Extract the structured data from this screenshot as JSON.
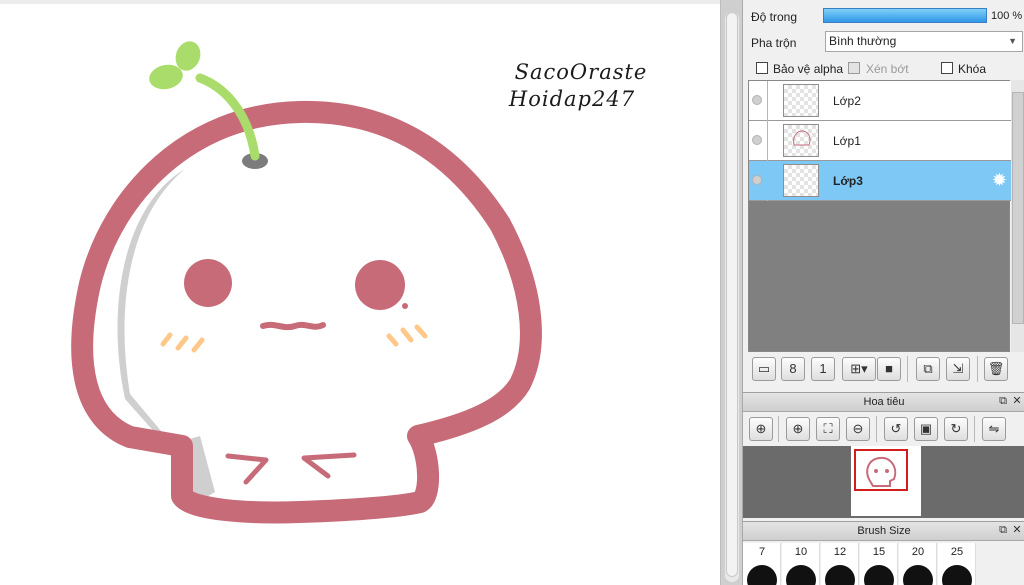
{
  "canvas": {
    "signature_line1": "SacoOraste",
    "signature_line2": "Hoidap247",
    "colors": {
      "outline": "#c76b79",
      "sprout": "#a9dc6a",
      "shade": "#cfcfcf",
      "blush": "#ffc78a"
    }
  },
  "layer_panel": {
    "opacity_label": "Độ trong",
    "opacity_value": "100 %",
    "opacity_fraction": 1.0,
    "blend_label": "Pha trộn",
    "blend_value": "Bình thường",
    "protect_alpha_label": "Bảo vệ alpha",
    "clipping_label": "Xén bớt",
    "lock_label": "Khóa",
    "layers": [
      {
        "name": "Lớp2",
        "selected": false
      },
      {
        "name": "Lớp1",
        "selected": false
      },
      {
        "name": "Lớp3",
        "selected": true
      }
    ],
    "accent_color": "#7ec8f6"
  },
  "layer_toolbar": {
    "icons": [
      "new-layer-icon",
      "new-8bit-layer-icon",
      "new-1bit-layer-icon",
      "add-layer-menu-icon",
      "new-folder-icon",
      "duplicate-layer-icon",
      "merge-down-icon",
      "delete-layer-icon"
    ],
    "label_8bit": "8",
    "label_1bit": "1"
  },
  "navigator": {
    "title": "Hoa tiêu",
    "icons": [
      "zoom-actual-icon",
      "zoom-in-icon",
      "fit-window-icon",
      "zoom-out-icon",
      "rotate-left-icon",
      "reset-rotation-icon",
      "rotate-right-icon",
      "flip-horizontal-icon"
    ]
  },
  "brush_size": {
    "title": "Brush Size",
    "sizes": [
      "7",
      "10",
      "12",
      "15",
      "20",
      "25"
    ]
  }
}
